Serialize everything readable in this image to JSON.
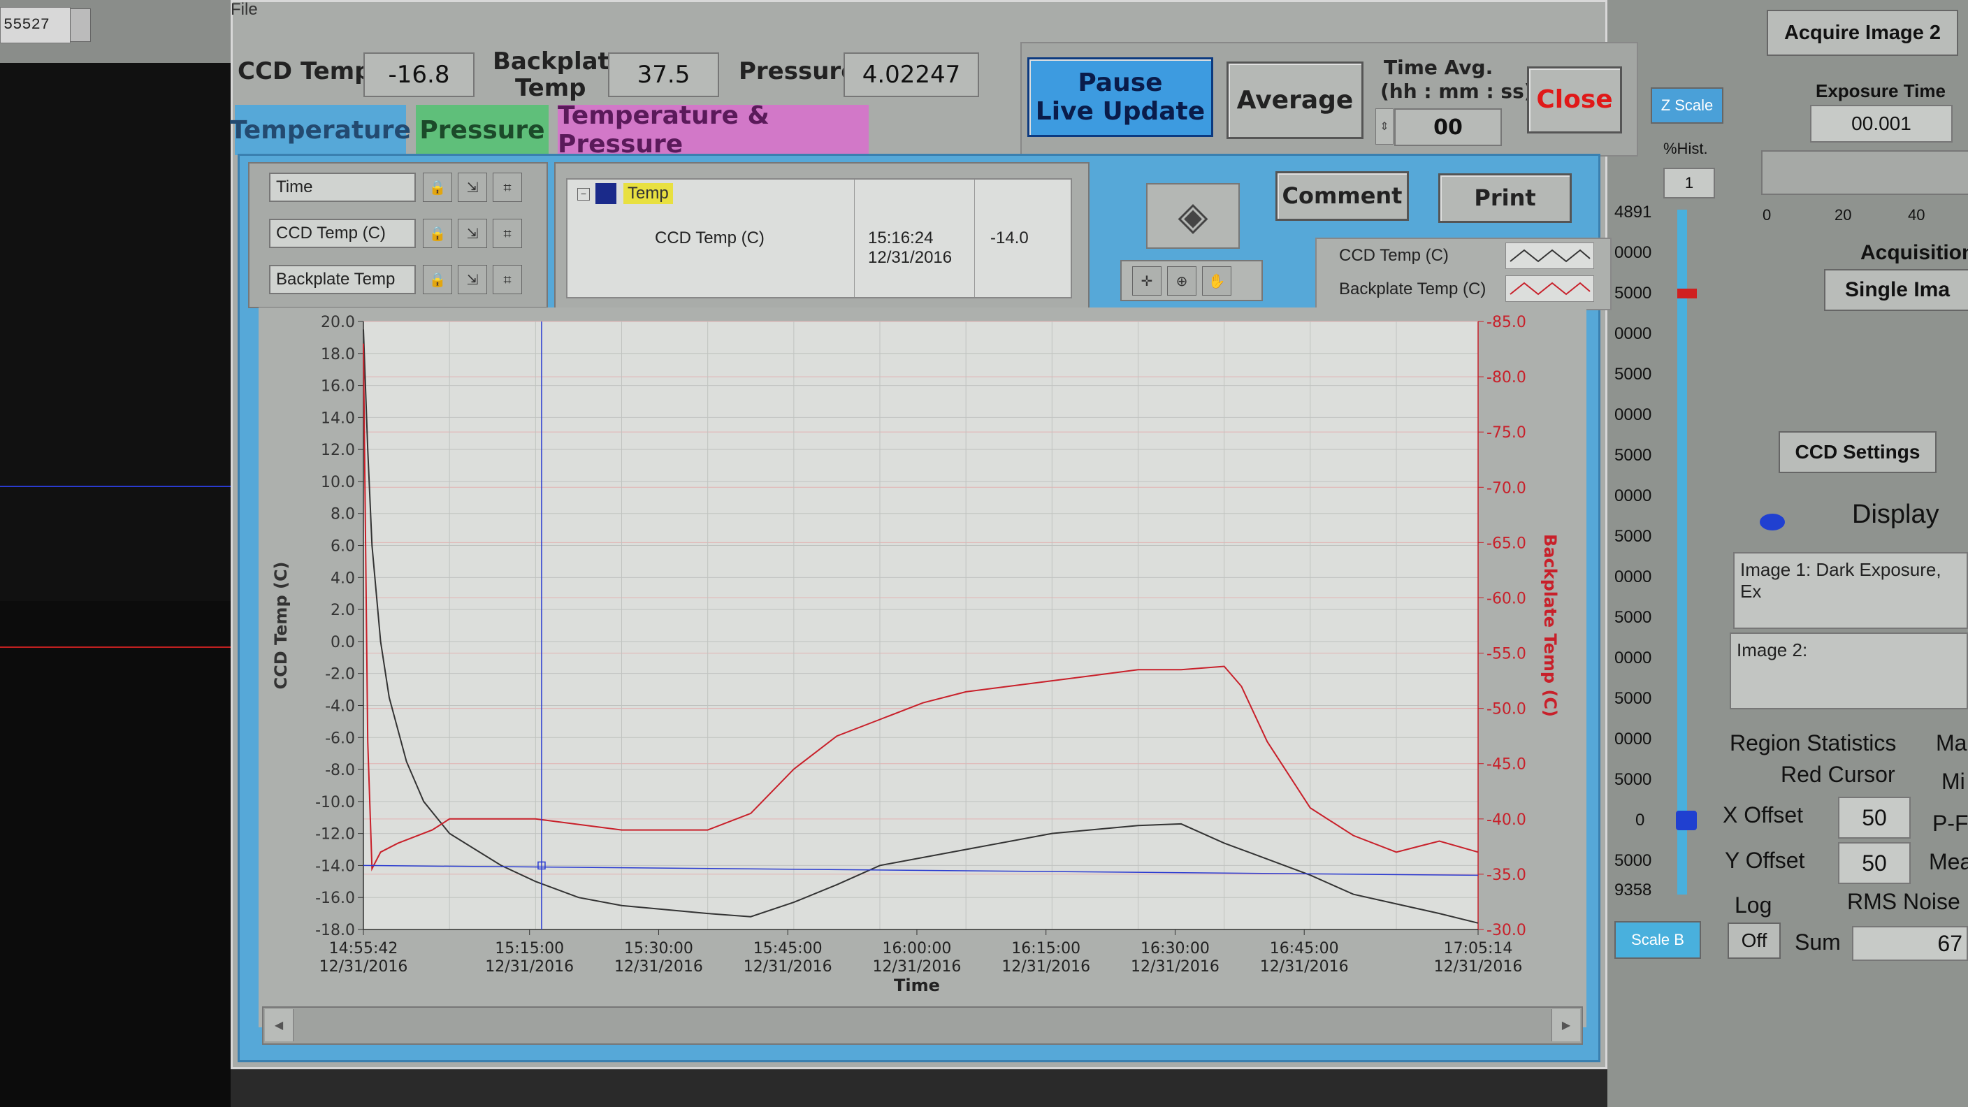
{
  "left_window": {
    "field_value": "55527"
  },
  "menu": {
    "file": "File"
  },
  "status": {
    "ccd_temp_label": "CCD Temp",
    "ccd_temp_value": "-16.8",
    "backplate_label_1": "Backplate",
    "backplate_label_2": "Temp",
    "backplate_value": "37.5",
    "pressure_label": "Pressure",
    "pressure_value": "4.02247"
  },
  "buttons": {
    "pause_1": "Pause",
    "pause_2": "Live Update",
    "average": "Average",
    "close": "Close",
    "comment": "Comment",
    "print": "Print"
  },
  "time_avg": {
    "label_1": "Time Avg.",
    "label_2": "(hh : mm : ss)",
    "value": "00"
  },
  "tabs": [
    "Temperature",
    "Pressure",
    "Temperature & Pressure"
  ],
  "channel_selectors": [
    "Time",
    "CCD Temp (C)",
    "Backplate Temp"
  ],
  "cursor_table": {
    "group": "Temp",
    "item": "CCD Temp (C)",
    "time": "15:16:24",
    "date": "12/31/2016",
    "value": "-14.0"
  },
  "legend": [
    {
      "name": "CCD Temp (C)",
      "color": "#333333"
    },
    {
      "name": "Backplate Temp (C)",
      "color": "#c8202a"
    }
  ],
  "chart_data": {
    "type": "line",
    "xlabel": "Time",
    "ylabel_left": "CCD Temp (C)",
    "ylabel_right": "Backplate Temp (C)",
    "ylim_left": [
      -18.0,
      20.0
    ],
    "ylim_right": [
      30.0,
      85.0
    ],
    "x_ticks_time": [
      "14:55:42",
      "15:15:00",
      "15:30:00",
      "15:45:00",
      "16:00:00",
      "16:15:00",
      "16:30:00",
      "16:45:00",
      "17:05:14"
    ],
    "x_ticks_date": "12/31/2016",
    "xlim_minutes": [
      0,
      129.5
    ],
    "y_ticks_left": [
      "20.0",
      "18.0",
      "16.0",
      "14.0",
      "12.0",
      "10.0",
      "8.0",
      "6.0",
      "4.0",
      "2.0",
      "0.0",
      "-2.0",
      "-4.0",
      "-6.0",
      "-8.0",
      "-10.0",
      "-12.0",
      "-14.0",
      "-16.0",
      "-18.0"
    ],
    "y_ticks_right": [
      "85.0",
      "80.0",
      "75.0",
      "70.0",
      "65.0",
      "60.0",
      "55.0",
      "50.0",
      "45.0",
      "40.0",
      "35.0",
      "30.0"
    ],
    "grid": true,
    "series": [
      {
        "name": "CCD Temp (C)",
        "axis": "left",
        "color": "#333333",
        "x": [
          0,
          0.5,
          1,
          2,
          3,
          5,
          7,
          10,
          13,
          16,
          20,
          25,
          30,
          40,
          45,
          50,
          55,
          60,
          70,
          80,
          90,
          95,
          100,
          103,
          110,
          115,
          120,
          125,
          129.5
        ],
        "y": [
          19.5,
          12.0,
          6.0,
          0.0,
          -3.5,
          -7.5,
          -10.0,
          -12.0,
          -13.0,
          -14.0,
          -15.0,
          -16.0,
          -16.5,
          -17.0,
          -17.2,
          -16.3,
          -15.2,
          -14.0,
          -13.0,
          -12.0,
          -11.5,
          -11.4,
          -12.6,
          -13.2,
          -14.6,
          -15.8,
          -16.4,
          -17.0,
          -17.6
        ]
      },
      {
        "name": "Backplate Temp (C)",
        "axis": "right",
        "color": "#c8202a",
        "x": [
          0,
          0.5,
          1,
          2,
          4,
          8,
          10,
          15,
          20,
          30,
          40,
          45,
          50,
          55,
          60,
          65,
          70,
          75,
          80,
          85,
          90,
          95,
          100,
          102,
          105,
          110,
          115,
          120,
          125,
          129.5
        ],
        "y": [
          83.0,
          47.0,
          35.5,
          37.0,
          37.8,
          39.0,
          40.0,
          40.0,
          40.0,
          39.0,
          39.0,
          40.5,
          44.5,
          47.5,
          49.0,
          50.5,
          51.5,
          52.0,
          52.5,
          53.0,
          53.5,
          53.5,
          53.8,
          52.0,
          47.0,
          41.0,
          38.5,
          37.0,
          38.0,
          37.0
        ]
      }
    ],
    "cursor": {
      "x_minutes": 20.7,
      "y_left": -14.0
    }
  },
  "right_panel": {
    "acquire": "Acquire Image 2",
    "zscale": "Z Scale",
    "hist_label": "%Hist.",
    "hist_value": "1",
    "exposure_label": "Exposure Time",
    "exposure_value": "00.001",
    "slider_ticks": [
      "0",
      "20",
      "40"
    ],
    "acquisition": "Acquisition",
    "single": "Single Ima",
    "ccd_settings": "CCD Settings",
    "display": "Display",
    "image1": "Image 1: Dark Exposure, Ex",
    "image2": "Image 2:",
    "region_stats": "Region Statistics",
    "red_cursor": "Red Cursor",
    "x_offset_label": "X Offset",
    "x_offset_value": "50",
    "y_offset_label": "Y Offset",
    "y_offset_value": "50",
    "log": "Log",
    "off": "Off",
    "sum": "Sum",
    "sum_value": "67",
    "ma": "Ma",
    "mi": "Mi",
    "pf": "P-F",
    "mean": "Mear",
    "rms": "RMS Noise",
    "scale_b": "Scale B",
    "scale_ticks": [
      "4891",
      "0000",
      "5000",
      "0000",
      "5000",
      "0000",
      "5000",
      "0000",
      "5000",
      "0000",
      "5000",
      "0000",
      "5000",
      "0000",
      "5000",
      "0",
      "5000",
      "9358"
    ]
  }
}
